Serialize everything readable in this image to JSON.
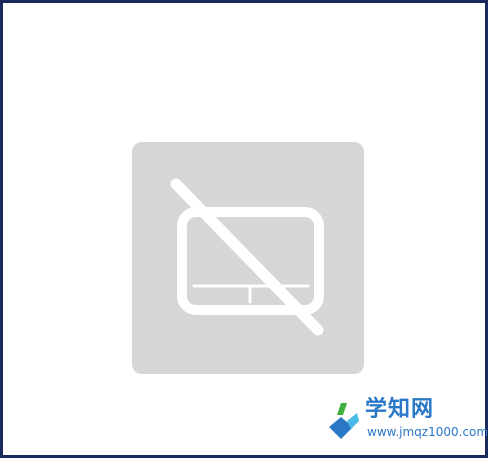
{
  "icon": {
    "name": "touchpad-disabled-icon",
    "tile_color": "#d6d6d6",
    "glyph_color": "#ffffff"
  },
  "watermark": {
    "title": "学知网",
    "url": "www.jmqz1000.com",
    "title_color": "#2a78c6",
    "logo_colors": [
      "#2a78c6",
      "#3fae3a",
      "#49b9e8"
    ]
  },
  "frame": {
    "border_color": "#1b2a5c"
  }
}
